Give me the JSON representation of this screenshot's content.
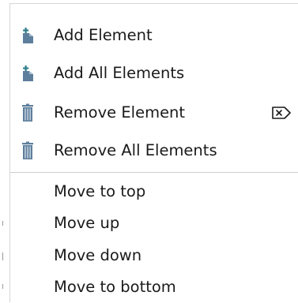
{
  "context_menu": {
    "items": [
      {
        "label": "Add Element",
        "icon": "add-element-icon"
      },
      {
        "label": "Add All Elements",
        "icon": "add-all-elements-icon"
      },
      {
        "label": "Remove Element",
        "icon": "trash-icon",
        "shortcut_icon": "delete-key-icon"
      },
      {
        "label": "Remove All Elements",
        "icon": "trash-icon"
      },
      {
        "label": "Move to top"
      },
      {
        "label": "Move up"
      },
      {
        "label": "Move down"
      },
      {
        "label": "Move to bottom"
      }
    ]
  },
  "colors": {
    "icon_blue": "#5e7f9c",
    "icon_teal": "#2f7d8a",
    "text": "#1a1a1a",
    "separator": "#cfcfcf"
  }
}
